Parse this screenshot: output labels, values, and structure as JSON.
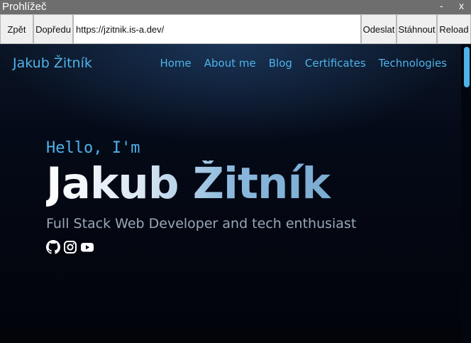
{
  "window": {
    "title": "Prohlížeč",
    "minimize_label": "-",
    "close_label": "x"
  },
  "toolbar": {
    "back_label": "Zpět",
    "forward_label": "Dopředu",
    "url": "https://jzitnik.is-a.dev/",
    "submit_label": "Odeslat",
    "download_label": "Stáhnout",
    "reload_label": "Reload"
  },
  "site": {
    "brand": "Jakub Žitník",
    "nav": [
      "Home",
      "About me",
      "Blog",
      "Certificates",
      "Technologies"
    ],
    "hero": {
      "greeting": "Hello, I'm",
      "name": "Jakub Žitník",
      "tagline": "Full Stack Web Developer and tech enthusiast"
    },
    "socials": [
      {
        "icon": "github-icon"
      },
      {
        "icon": "instagram-icon"
      },
      {
        "icon": "youtube-icon"
      }
    ],
    "colors": {
      "accent": "#4fb3ea",
      "background": "#03060f",
      "tagline": "#9aa7b8"
    }
  }
}
